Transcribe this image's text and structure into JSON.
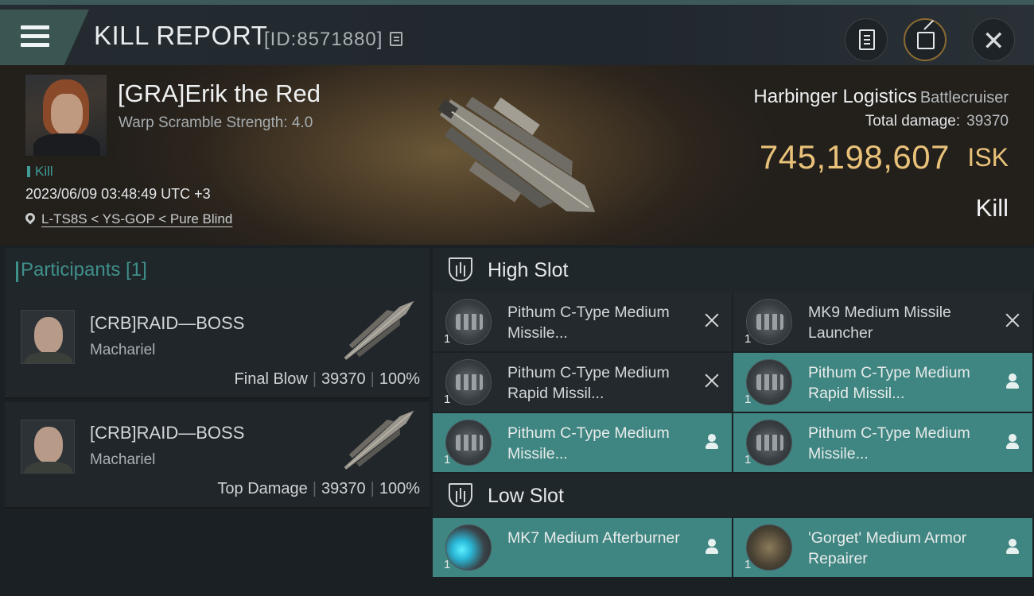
{
  "header": {
    "title": "KILL REPORT",
    "id_text": "[ID:8571880]",
    "icons": [
      "menu-icon",
      "copy-icon",
      "report-icon",
      "share-icon",
      "close-icon"
    ],
    "close_glyph": "✕"
  },
  "victim": {
    "name": "[GRA]Erik the Red",
    "warp_scramble": "Warp Scramble Strength: 4.0",
    "tag": "Kill",
    "datetime": "2023/06/09 03:48:49 UTC +3",
    "location": "L-TS8S < YS-GOP < Pure Blind",
    "badge": "+"
  },
  "ship": {
    "name": "Harbinger Logistics",
    "class": "Battlecruiser",
    "total_damage_label": "Total damage:",
    "total_damage": "39370",
    "isk_value": "745,198,607",
    "isk_unit": "ISK",
    "result": "Kill"
  },
  "participants": {
    "header": "Participants [1]",
    "rows": [
      {
        "name": "[CRB]RAID—BOSS",
        "ship": "Machariel",
        "role": "Final Blow",
        "damage": "39370",
        "percent": "100%",
        "sep": "|"
      },
      {
        "name": "[CRB]RAID—BOSS",
        "ship": "Machariel",
        "role": "Top Damage",
        "damage": "39370",
        "percent": "100%",
        "sep": "|"
      }
    ]
  },
  "slots": {
    "high": {
      "title": "High Slot",
      "modules": [
        {
          "name": "Pithum C-Type Medium Missile...",
          "qty": "1",
          "state": "destroyed"
        },
        {
          "name": "MK9 Medium Missile Launcher",
          "qty": "1",
          "state": "destroyed"
        },
        {
          "name": "Pithum C-Type Medium Rapid Missil...",
          "qty": "1",
          "state": "destroyed"
        },
        {
          "name": "Pithum C-Type Medium Rapid Missil...",
          "qty": "1",
          "state": "dropped"
        },
        {
          "name": "Pithum C-Type Medium Missile...",
          "qty": "1",
          "state": "dropped"
        },
        {
          "name": "Pithum C-Type Medium Missile...",
          "qty": "1",
          "state": "dropped"
        }
      ]
    },
    "low": {
      "title": "Low Slot",
      "modules": [
        {
          "name": "MK7 Medium Afterburner",
          "qty": "1",
          "state": "dropped"
        },
        {
          "name": "'Gorget' Medium Armor Repairer",
          "qty": "1",
          "state": "dropped"
        }
      ]
    }
  },
  "colors": {
    "accent_teal": "#3f8581",
    "isk_gold": "#e9c27a",
    "panel": "#23292d"
  }
}
